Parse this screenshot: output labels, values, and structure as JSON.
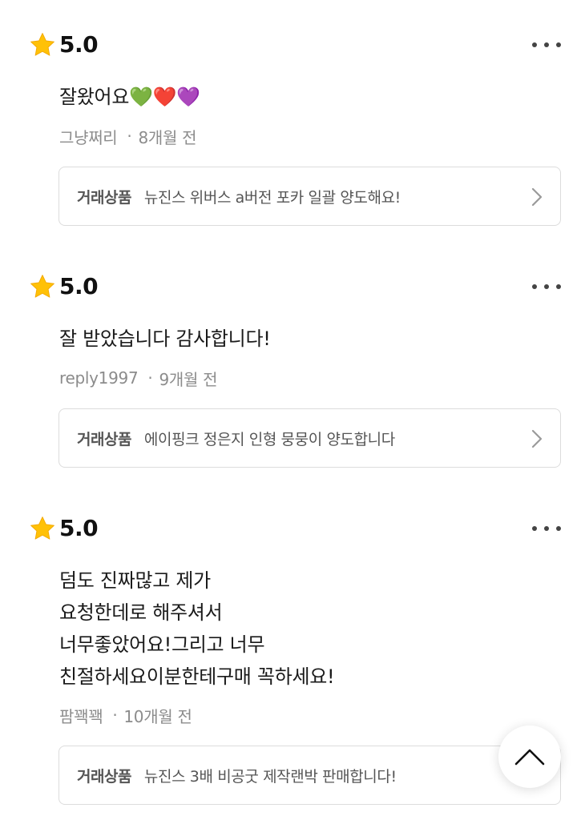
{
  "reviews": [
    {
      "rating": "5.0",
      "text": "잘왔어요💚❤️💜",
      "author": "그냥쩌리",
      "separator": "·",
      "time_ago": "8개월 전",
      "product_label": "거래상품",
      "product_title": "뉴진스 위버스 a버전 포카 일괄 양도해요!"
    },
    {
      "rating": "5.0",
      "text": "잘 받았습니다 감사합니다!",
      "author": "reply1997",
      "separator": "·",
      "time_ago": "9개월 전",
      "product_label": "거래상품",
      "product_title": "에이핑크 정은지 인형 뭉뭉이 양도합니다"
    },
    {
      "rating": "5.0",
      "text": "덤도 진짜많고 제가\n요청한데로 해주셔서\n너무좋았어요!그리고 너무\n친절하세요이분한테구매 꼭하세요!",
      "author": "팜꽥꽥",
      "separator": "·",
      "time_ago": "10개월 전",
      "product_label": "거래상품",
      "product_title": "뉴진스 3배 비공굿 제작랜박 판매합니다!"
    }
  ],
  "icons": {
    "star": "star-icon",
    "more": "more-icon",
    "chevron": "chevron-right-icon",
    "scroll_top": "chevron-up-icon"
  },
  "colors": {
    "star": "#FFC107",
    "card_border": "#dcdcdc",
    "meta_text": "#8c8c8c"
  }
}
